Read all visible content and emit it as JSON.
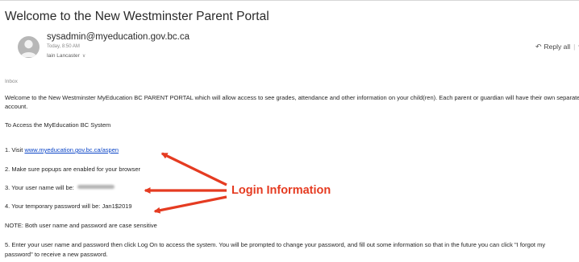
{
  "email": {
    "subject": "Welcome to the New Westminster Parent Portal",
    "sender": "sysadmin@myeducation.gov.bc.ca",
    "time": "Today, 8:50 AM",
    "to": "Iain Lancaster",
    "to_chevron": "∨",
    "reply_all_label": "Reply all",
    "reply_icon": "↶",
    "folder": "Inbox"
  },
  "body": {
    "intro1": "Welcome to the New Westminster MyEducation BC PARENT PORTAL which will allow access to see grades, attendance and other information on your child(ren). Each parent or guardian will have their own separate",
    "intro2": "account.",
    "access": "To Access the MyEducation BC System",
    "step1_prefix": "1. Visit ",
    "step1_link": "www.myeducation.gov.bc.ca/aspen",
    "step2": "2. Make sure popups are enabled for your browser",
    "step3": "3.  Your user name will be:",
    "step4": "4.  Your temporary password will be: Jan1$2019",
    "note": "NOTE: Both user name and password are case sensitive",
    "step5a": "5.  Enter your user name and password then click Log On to access the system.  You will be prompted to change your password, and fill out some information so that in the future you can click \"I forgot my",
    "step5b": "password\" to receive a new password."
  },
  "annotation": {
    "label": "Login Information",
    "color": "#e53b21"
  }
}
